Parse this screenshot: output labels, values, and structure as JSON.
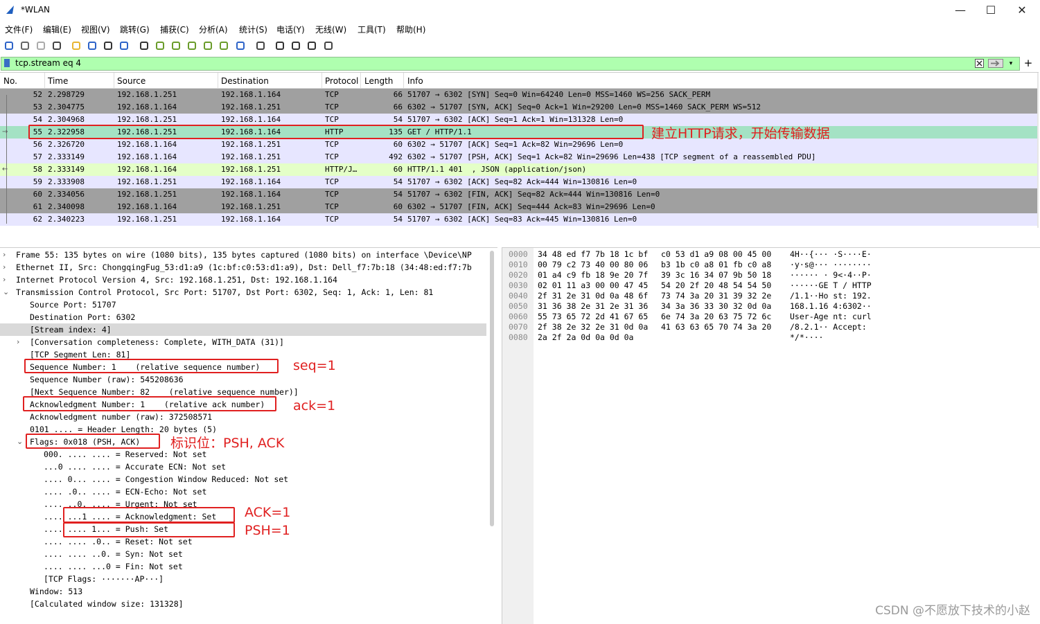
{
  "window": {
    "title": "*WLAN",
    "min_label": "—",
    "max_label": "☐",
    "close_label": "✕"
  },
  "menu": [
    "文件(F)",
    "编辑(E)",
    "视图(V)",
    "跳转(G)",
    "捕获(C)",
    "分析(A)",
    "统计(S)",
    "电话(Y)",
    "无线(W)",
    "工具(T)",
    "帮助(H)"
  ],
  "toolbar_icons": [
    "shark-fin-start-icon",
    "stop-square-icon",
    "restart-icon",
    "options-gear-icon",
    "open-folder-icon",
    "save-file-icon",
    "close-file-icon",
    "reload-icon",
    "find-icon",
    "back-arrow-icon",
    "forward-arrow-icon",
    "goto-packet-icon",
    "first-packet-icon",
    "last-packet-icon",
    "autoscroll-icon",
    "colorize-icon",
    "zoom-in-icon",
    "zoom-out-icon",
    "zoom-reset-icon",
    "resize-columns-icon"
  ],
  "filter": {
    "value": "tcp.stream eq 4"
  },
  "columns": [
    "No.",
    "Time",
    "Source",
    "Destination",
    "Protocol",
    "Length",
    "Info"
  ],
  "packets": [
    {
      "no": "52",
      "time": "2.298729",
      "src": "192.168.1.251",
      "dst": "192.168.1.164",
      "proto": "TCP",
      "len": "66",
      "info": "51707 → 6302 [SYN] Seq=0 Win=64240 Len=0 MSS=1460 WS=256 SACK_PERM",
      "bg": "#a0a0a0"
    },
    {
      "no": "53",
      "time": "2.304775",
      "src": "192.168.1.164",
      "dst": "192.168.1.251",
      "proto": "TCP",
      "len": "66",
      "info": "6302 → 51707 [SYN, ACK] Seq=0 Ack=1 Win=29200 Len=0 MSS=1460 SACK_PERM WS=512",
      "bg": "#a0a0a0"
    },
    {
      "no": "54",
      "time": "2.304968",
      "src": "192.168.1.251",
      "dst": "192.168.1.164",
      "proto": "TCP",
      "len": "54",
      "info": "51707 → 6302 [ACK] Seq=1 Ack=1 Win=131328 Len=0",
      "bg": "#e7e6ff"
    },
    {
      "no": "55",
      "time": "2.322958",
      "src": "192.168.1.251",
      "dst": "192.168.1.164",
      "proto": "HTTP",
      "len": "135",
      "info": "GET / HTTP/1.1",
      "bg": "#a4e2c4"
    },
    {
      "no": "56",
      "time": "2.326720",
      "src": "192.168.1.164",
      "dst": "192.168.1.251",
      "proto": "TCP",
      "len": "60",
      "info": "6302 → 51707 [ACK] Seq=1 Ack=82 Win=29696 Len=0",
      "bg": "#e7e6ff"
    },
    {
      "no": "57",
      "time": "2.333149",
      "src": "192.168.1.164",
      "dst": "192.168.1.251",
      "proto": "TCP",
      "len": "492",
      "info": "6302 → 51707 [PSH, ACK] Seq=1 Ack=82 Win=29696 Len=438 [TCP segment of a reassembled PDU]",
      "bg": "#e7e6ff"
    },
    {
      "no": "58",
      "time": "2.333149",
      "src": "192.168.1.164",
      "dst": "192.168.1.251",
      "proto": "HTTP/J…",
      "len": "60",
      "info": "HTTP/1.1 401  , JSON (application/json)",
      "bg": "#e4ffc7"
    },
    {
      "no": "59",
      "time": "2.333908",
      "src": "192.168.1.251",
      "dst": "192.168.1.164",
      "proto": "TCP",
      "len": "54",
      "info": "51707 → 6302 [ACK] Seq=82 Ack=444 Win=130816 Len=0",
      "bg": "#e7e6ff"
    },
    {
      "no": "60",
      "time": "2.334056",
      "src": "192.168.1.251",
      "dst": "192.168.1.164",
      "proto": "TCP",
      "len": "54",
      "info": "51707 → 6302 [FIN, ACK] Seq=82 Ack=444 Win=130816 Len=0",
      "bg": "#a0a0a0"
    },
    {
      "no": "61",
      "time": "2.340098",
      "src": "192.168.1.164",
      "dst": "192.168.1.251",
      "proto": "TCP",
      "len": "60",
      "info": "6302 → 51707 [FIN, ACK] Seq=444 Ack=83 Win=29696 Len=0",
      "bg": "#a0a0a0"
    },
    {
      "no": "62",
      "time": "2.340223",
      "src": "192.168.1.251",
      "dst": "192.168.1.164",
      "proto": "TCP",
      "len": "54",
      "info": "51707 → 6302 [ACK] Seq=83 Ack=445 Win=130816 Len=0",
      "bg": "#e7e6ff"
    }
  ],
  "details": [
    {
      "a": "›",
      "i": 0,
      "t": "Frame 55: 135 bytes on wire (1080 bits), 135 bytes captured (1080 bits) on interface \\Device\\NP"
    },
    {
      "a": "›",
      "i": 0,
      "t": "Ethernet II, Src: ChongqingFug_53:d1:a9 (1c:bf:c0:53:d1:a9), Dst: Dell_f7:7b:18 (34:48:ed:f7:7b"
    },
    {
      "a": "›",
      "i": 0,
      "t": "Internet Protocol Version 4, Src: 192.168.1.251, Dst: 192.168.1.164"
    },
    {
      "a": "⌄",
      "i": 0,
      "t": "Transmission Control Protocol, Src Port: 51707, Dst Port: 6302, Seq: 1, Ack: 1, Len: 81"
    },
    {
      "a": "",
      "i": 1,
      "t": "Source Port: 51707"
    },
    {
      "a": "",
      "i": 1,
      "t": "Destination Port: 6302"
    },
    {
      "a": "",
      "i": 1,
      "t": "[Stream index: 4]",
      "hl": true
    },
    {
      "a": "›",
      "i": 1,
      "t": "[Conversation completeness: Complete, WITH_DATA (31)]"
    },
    {
      "a": "",
      "i": 1,
      "t": "[TCP Segment Len: 81]"
    },
    {
      "a": "",
      "i": 1,
      "t": "Sequence Number: 1    (relative sequence number)"
    },
    {
      "a": "",
      "i": 1,
      "t": "Sequence Number (raw): 545208636"
    },
    {
      "a": "",
      "i": 1,
      "t": "[Next Sequence Number: 82    (relative sequence number)]"
    },
    {
      "a": "",
      "i": 1,
      "t": "Acknowledgment Number: 1    (relative ack number)"
    },
    {
      "a": "",
      "i": 1,
      "t": "Acknowledgment number (raw): 372508571"
    },
    {
      "a": "",
      "i": 1,
      "t": "0101 .... = Header Length: 20 bytes (5)"
    },
    {
      "a": "⌄",
      "i": 1,
      "t": "Flags: 0x018 (PSH, ACK)"
    },
    {
      "a": "",
      "i": 2,
      "t": "000. .... .... = Reserved: Not set"
    },
    {
      "a": "",
      "i": 2,
      "t": "...0 .... .... = Accurate ECN: Not set"
    },
    {
      "a": "",
      "i": 2,
      "t": ".... 0... .... = Congestion Window Reduced: Not set"
    },
    {
      "a": "",
      "i": 2,
      "t": ".... .0.. .... = ECN-Echo: Not set"
    },
    {
      "a": "",
      "i": 2,
      "t": ".... ..0. .... = Urgent: Not set"
    },
    {
      "a": "",
      "i": 2,
      "t": ".... ...1 .... = Acknowledgment: Set"
    },
    {
      "a": "",
      "i": 2,
      "t": ".... .... 1... = Push: Set"
    },
    {
      "a": "",
      "i": 2,
      "t": ".... .... .0.. = Reset: Not set"
    },
    {
      "a": "",
      "i": 2,
      "t": ".... .... ..0. = Syn: Not set"
    },
    {
      "a": "",
      "i": 2,
      "t": ".... .... ...0 = Fin: Not set"
    },
    {
      "a": "",
      "i": 2,
      "t": "[TCP Flags: ·······AP···]"
    },
    {
      "a": "",
      "i": 1,
      "t": "Window: 513"
    },
    {
      "a": "",
      "i": 1,
      "t": "[Calculated window size: 131328]"
    }
  ],
  "hex": [
    {
      "off": "0000",
      "b1": "34 48 ed f7 7b 18 1c bf",
      "b2": "c0 53 d1 a9 08 00 45 00",
      "a": "4H··{··· ·S····E·"
    },
    {
      "off": "0010",
      "b1": "00 79 c2 73 40 00 80 06",
      "b2": "b3 1b c0 a8 01 fb c0 a8",
      "a": "·y·s@··· ········"
    },
    {
      "off": "0020",
      "b1": "01 a4 c9 fb 18 9e 20 7f",
      "b2": "39 3c 16 34 07 9b 50 18",
      "a": "······ · 9<·4··P·"
    },
    {
      "off": "0030",
      "b1": "02 01 11 a3 00 00 47 45",
      "b2": "54 20 2f 20 48 54 54 50",
      "a": "······GE T / HTTP"
    },
    {
      "off": "0040",
      "b1": "2f 31 2e 31 0d 0a 48 6f",
      "b2": "73 74 3a 20 31 39 32 2e",
      "a": "/1.1··Ho st: 192."
    },
    {
      "off": "0050",
      "b1": "31 36 38 2e 31 2e 31 36",
      "b2": "34 3a 36 33 30 32 0d 0a",
      "a": "168.1.16 4:6302··"
    },
    {
      "off": "0060",
      "b1": "55 73 65 72 2d 41 67 65",
      "b2": "6e 74 3a 20 63 75 72 6c",
      "a": "User-Age nt: curl"
    },
    {
      "off": "0070",
      "b1": "2f 38 2e 32 2e 31 0d 0a",
      "b2": "41 63 63 65 70 74 3a 20",
      "a": "/8.2.1·· Accept: "
    },
    {
      "off": "0080",
      "b1": "2a 2f 2a 0d 0a 0d 0a",
      "b2": "",
      "a": "*/*····"
    }
  ],
  "annotations": {
    "http_request": "建立HTTP请求，开始传输数据",
    "seq": "seq=1",
    "ack": "ack=1",
    "flags": "标识位：PSH, ACK",
    "ack_flag": "ACK=1",
    "psh_flag": "PSH=1"
  },
  "watermark": "CSDN @不愿放下技术的小赵",
  "colors": {
    "filter_bg": "#afffaf",
    "annotation_red": "#e02020",
    "selected_row": "#a4e2c4"
  }
}
